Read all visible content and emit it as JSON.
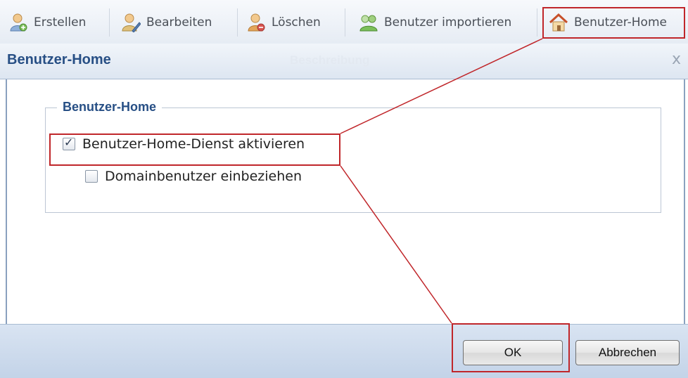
{
  "toolbar": {
    "items": [
      {
        "label": "Erstellen",
        "icon": "user-add-icon"
      },
      {
        "label": "Bearbeiten",
        "icon": "user-edit-icon"
      },
      {
        "label": "Löschen",
        "icon": "user-delete-icon"
      },
      {
        "label": "Benutzer importieren",
        "icon": "user-import-icon"
      },
      {
        "label": "Benutzer-Home",
        "icon": "home-icon"
      }
    ]
  },
  "dialog": {
    "title": "Benutzer-Home",
    "background_header": "Beschreibung",
    "close_symbol": "x",
    "group_label": "Benutzer-Home",
    "options": [
      {
        "label": "Benutzer-Home-Dienst aktivieren",
        "checked": true
      },
      {
        "label": "Domainbenutzer einbeziehen",
        "checked": false
      }
    ],
    "buttons": {
      "ok": "OK",
      "cancel": "Abbrechen"
    }
  },
  "colors": {
    "title": "#274f85",
    "annotation": "#c0262a",
    "footer": "#c3d3e8"
  }
}
